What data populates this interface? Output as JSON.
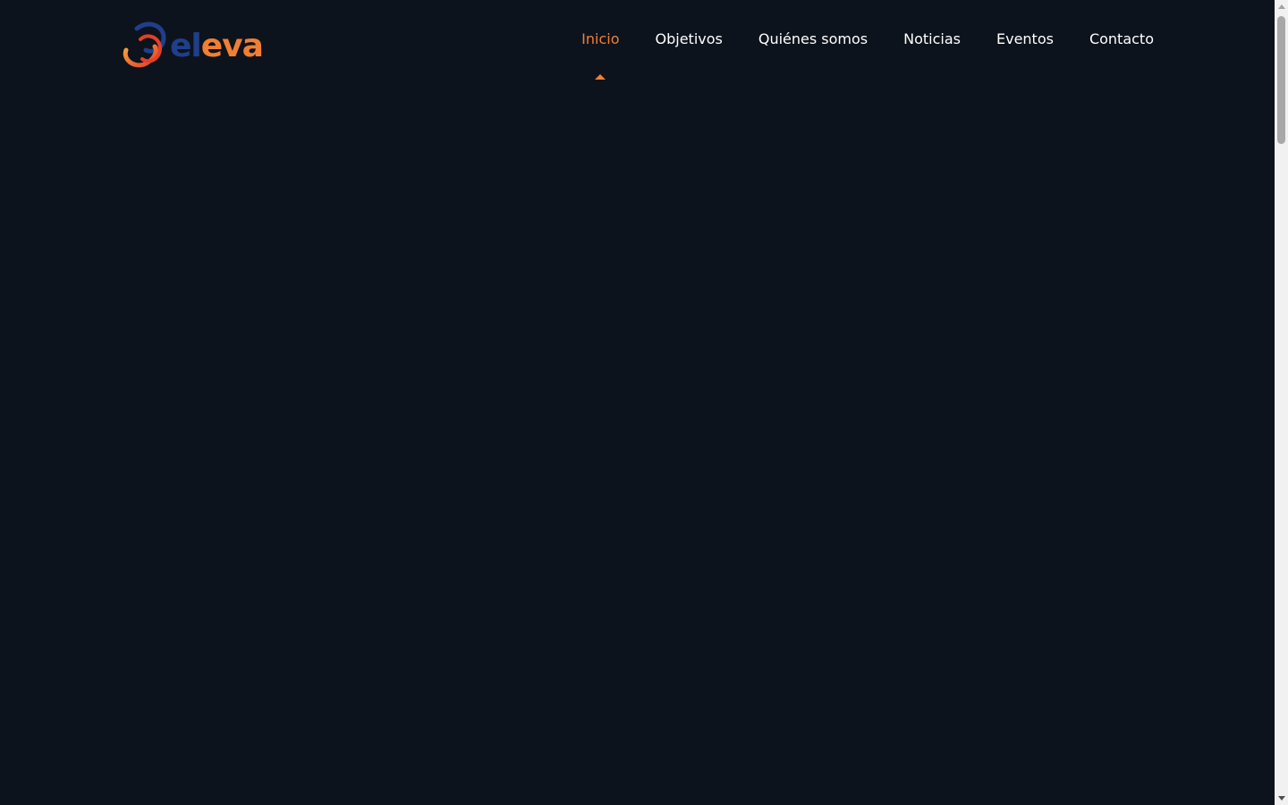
{
  "brand": {
    "logo_text_first": "el",
    "logo_text_second": "eva",
    "logo_icon": "interlocking-rings-icon",
    "colors": {
      "blue": "#1f3f8a",
      "orange": "#f07f34",
      "red": "#e33f2a",
      "background": "#0d131c"
    }
  },
  "nav": {
    "items": [
      {
        "label": "Inicio",
        "active": true
      },
      {
        "label": "Objetivos",
        "active": false
      },
      {
        "label": "Quiénes somos",
        "active": false
      },
      {
        "label": "Noticias",
        "active": false
      },
      {
        "label": "Eventos",
        "active": false
      },
      {
        "label": "Contacto",
        "active": false
      }
    ]
  }
}
